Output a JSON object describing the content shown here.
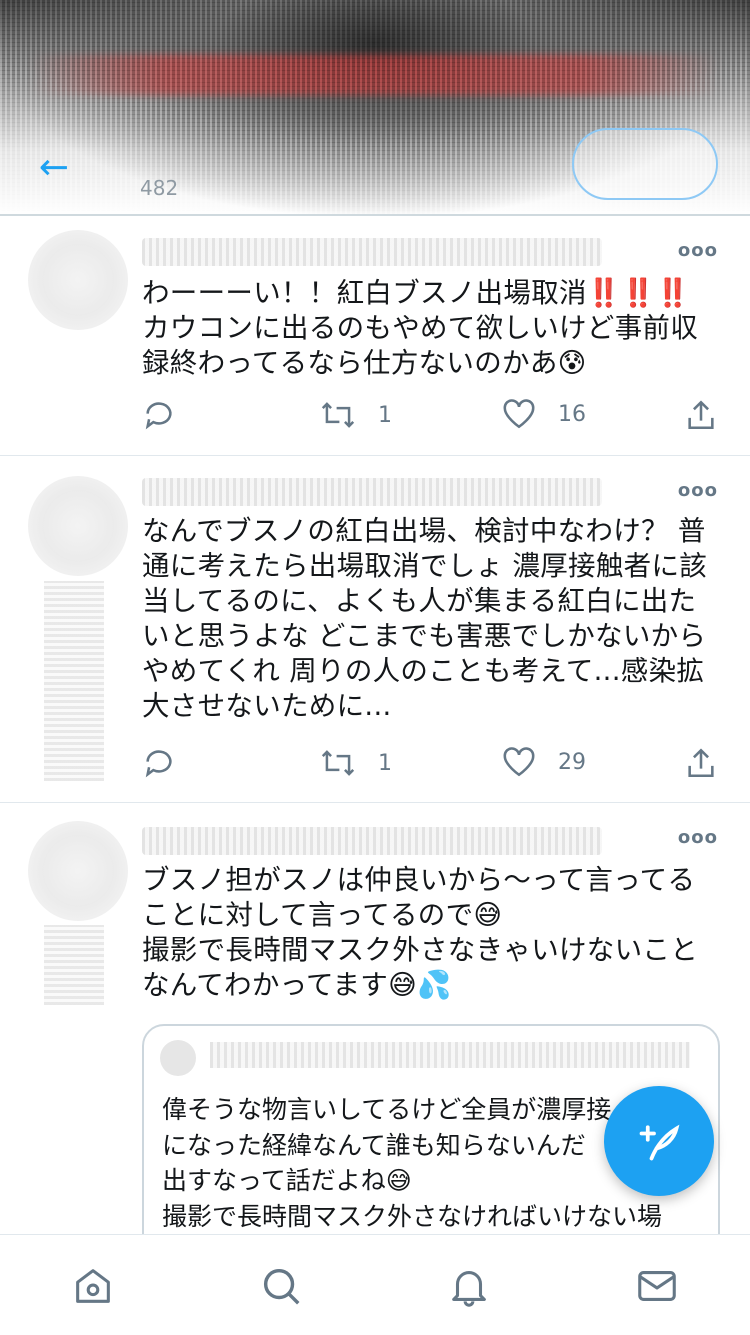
{
  "header": {
    "tweet_count_label": "482",
    "back_icon": "back-arrow-icon"
  },
  "tweets": [
    {
      "text": "わーーーい！！紅白ブスノ出場取消‼️‼️‼️\nカウコンに出るのもやめて欲しいけど事前収録終わってるなら仕方ないのかあ😰",
      "retweets": "1",
      "likes": "16"
    },
    {
      "text": "なんでブスノの紅白出場、検討中なわけ？ 普通に考えたら出場取消でしょ 濃厚接触者に該当してるのに、よくも人が集まる紅白に出たいと思うよな どこまでも害悪でしかないからやめてくれ 周りの人のことも考えて...感染拡大させないために...",
      "retweets": "1",
      "likes": "29"
    },
    {
      "text": "ブスノ担がスノは仲良いから〜って言ってることに対して言ってるので😅\n撮影で長時間マスク外さなきゃいけないことなんてわかってます😅💦",
      "quote_text": "偉そうな物言いしてるけど全員が濃厚接\nになった経緯なんて誰も知らないんだ\n出すなって話だよね😅\n撮影で長時間マスク外さなければいけない場"
    }
  ],
  "colors": {
    "accent": "#1da1f2",
    "text": "#14171a",
    "secondary": "#657786",
    "divider": "#e1e8ed"
  },
  "nav": [
    "home-icon",
    "search-icon",
    "notifications-icon",
    "messages-icon"
  ]
}
